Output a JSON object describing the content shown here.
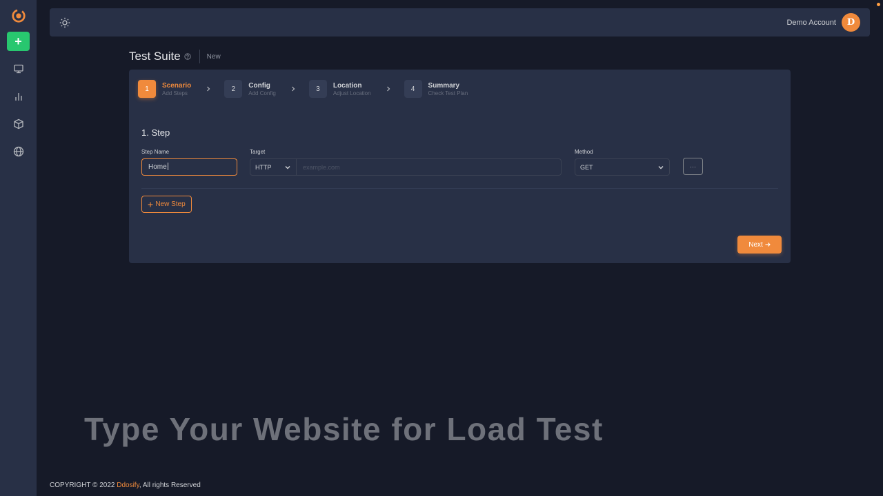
{
  "app": {
    "brand_color": "#f08a3c",
    "success_color": "#28c76f"
  },
  "sidebar": {
    "add_label": "+",
    "items": [
      {
        "icon": "monitor-icon"
      },
      {
        "icon": "bar-chart-icon"
      },
      {
        "icon": "box-icon"
      },
      {
        "icon": "globe-icon"
      }
    ]
  },
  "navbar": {
    "theme_icon": "sun-icon",
    "user_name": "Demo Account",
    "avatar_initial": "D"
  },
  "header": {
    "title": "Test Suite",
    "crumb": "New"
  },
  "wizard": {
    "steps": [
      {
        "num": "1",
        "title": "Scenario",
        "subtitle": "Add Steps",
        "active": true
      },
      {
        "num": "2",
        "title": "Config",
        "subtitle": "Add Config"
      },
      {
        "num": "3",
        "title": "Location",
        "subtitle": "Adjust Location"
      },
      {
        "num": "4",
        "title": "Summary",
        "subtitle": "Check Test Plan"
      }
    ]
  },
  "form": {
    "heading": "1. Step",
    "step_name_label": "Step Name",
    "step_name_value": "Home",
    "target_label": "Target",
    "protocol_value": "HTTP",
    "url_placeholder": "example.com",
    "method_label": "Method",
    "method_value": "GET",
    "more_label": "···",
    "new_step_label": "New Step",
    "next_label": "Next"
  },
  "caption": "Type Your Website for Load Test",
  "footer": {
    "prefix": "COPYRIGHT © 2022 ",
    "brand": "Ddosify",
    "suffix": ", All rights Reserved"
  }
}
